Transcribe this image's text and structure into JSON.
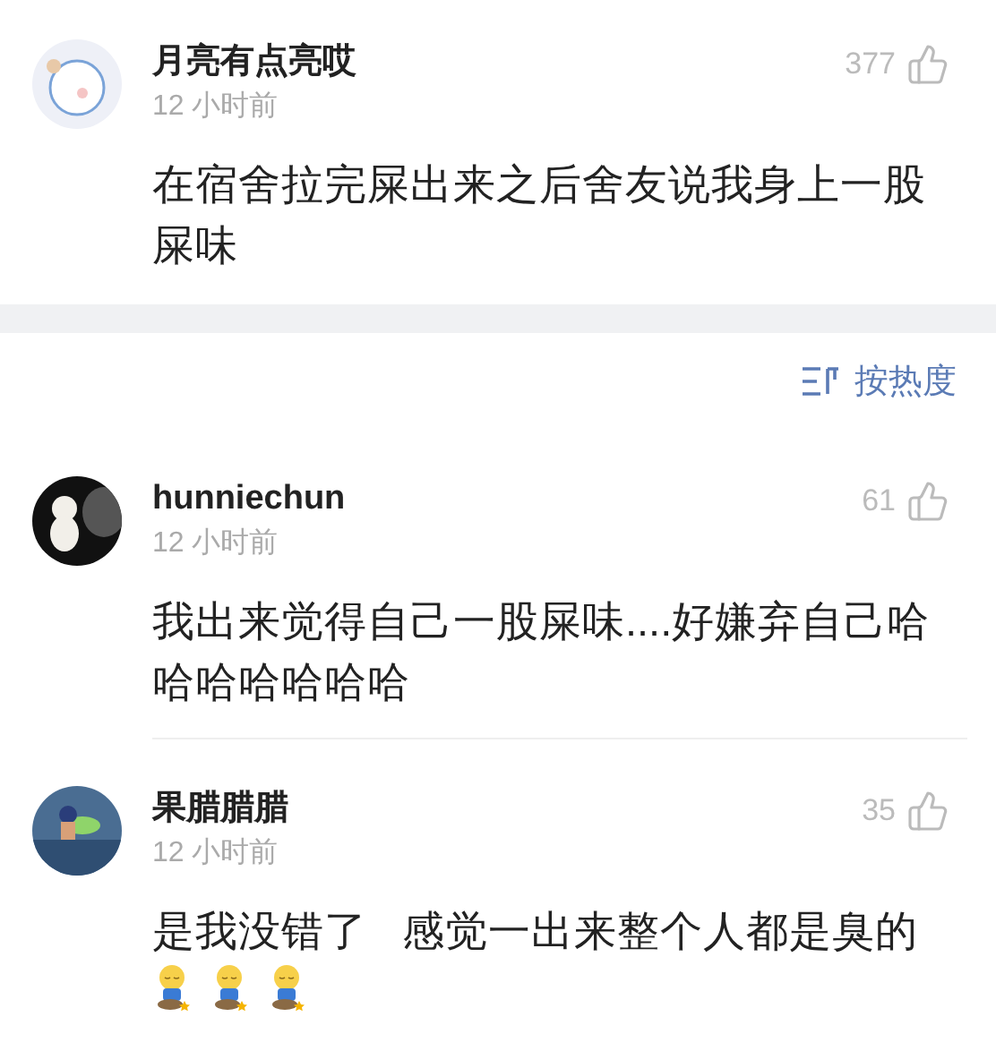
{
  "top_comment": {
    "name": "月亮有点亮哎",
    "likes": "377",
    "time": "12 小时前",
    "text": "在宿舍拉完屎出来之后舍友说我身上一股屎味"
  },
  "sort": {
    "label": "按热度"
  },
  "comments": [
    {
      "name": "hunniechun",
      "likes": "61",
      "time": "12 小时前",
      "text": "我出来觉得自己一股屎味....好嫌弃自己哈哈哈哈哈哈哈"
    },
    {
      "name": "果腊腊腊",
      "likes": "35",
      "time": "12 小时前",
      "text": "是我没错了   感觉一出来整个人都是臭的",
      "stickers": [
        {
          "kind": "toilet-face"
        },
        {
          "kind": "toilet-face"
        },
        {
          "kind": "toilet-face"
        }
      ]
    }
  ]
}
